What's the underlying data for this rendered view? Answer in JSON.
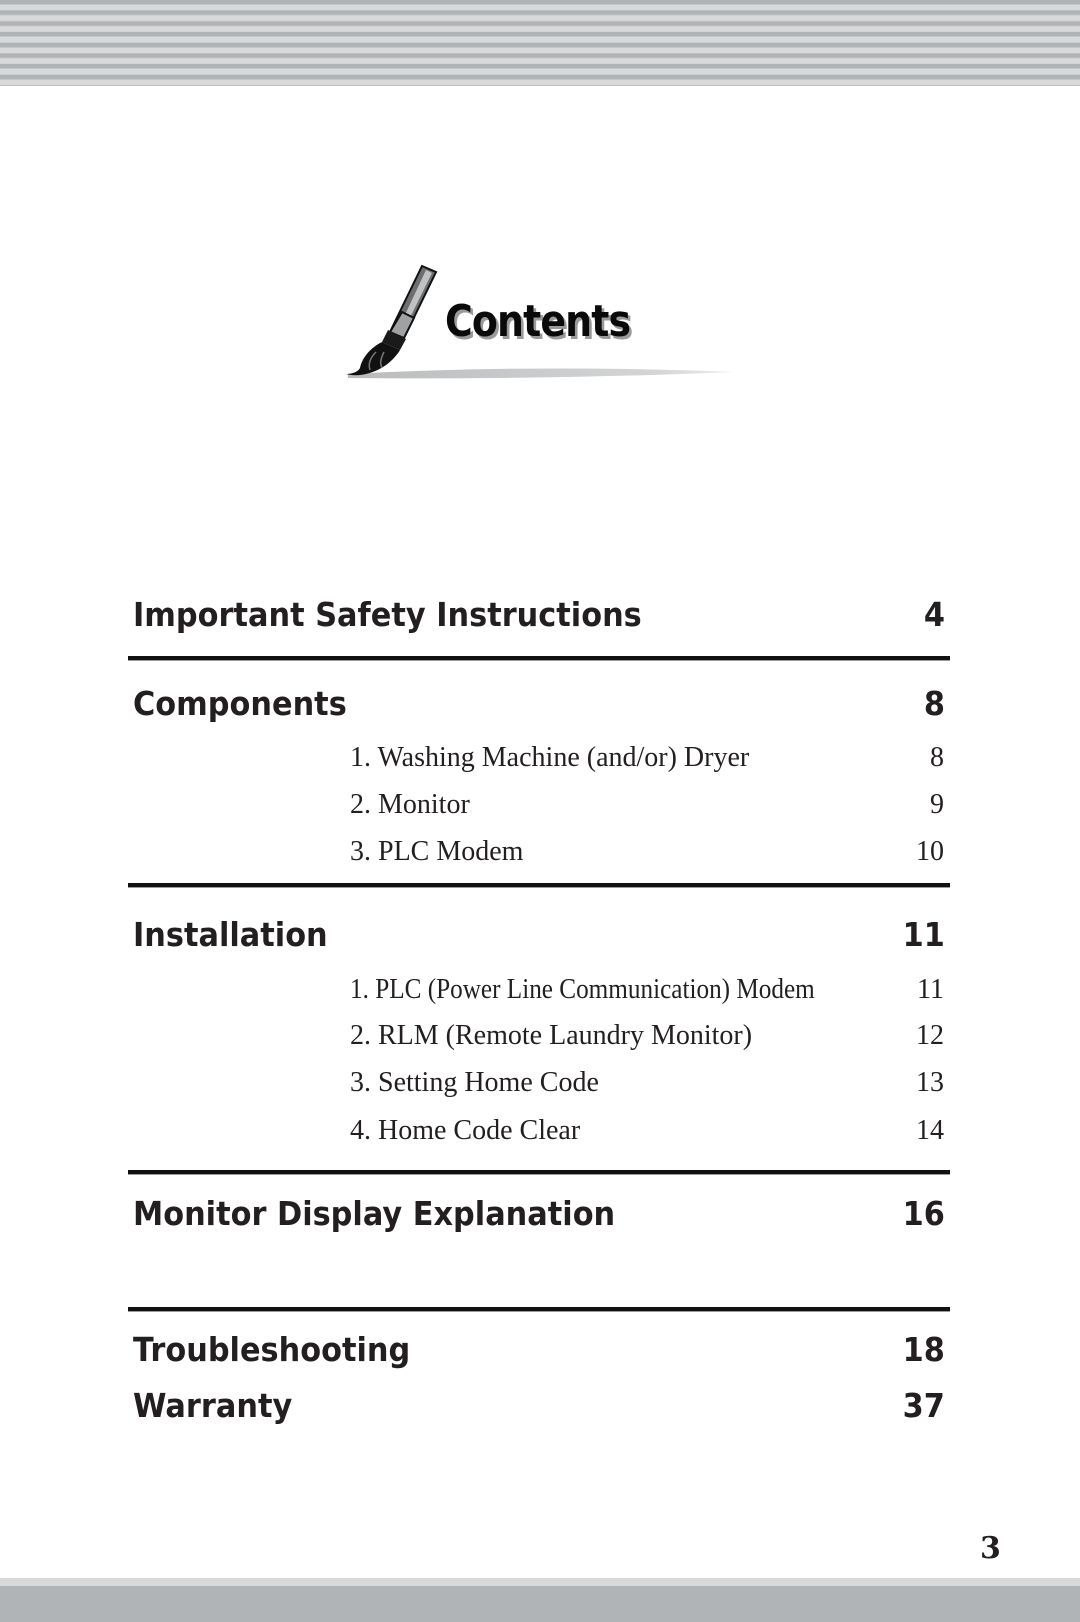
{
  "logo": {
    "title": "Contents",
    "icon": "paintbrush-icon"
  },
  "toc": {
    "sections": [
      {
        "title": "Important Safety Instructions",
        "page": "4",
        "items": []
      },
      {
        "title": "Components",
        "page": "8",
        "items": [
          {
            "label": "1. Washing Machine (and/or) Dryer",
            "page": "8"
          },
          {
            "label": "2. Monitor",
            "page": "9"
          },
          {
            "label": "3. PLC Modem",
            "page": "10"
          }
        ]
      },
      {
        "title": "Installation",
        "page": "11",
        "items": [
          {
            "label": "1. PLC (Power Line Communication) Modem",
            "page": "11"
          },
          {
            "label": "2. RLM (Remote Laundry Monitor)",
            "page": "12"
          },
          {
            "label": "3. Setting Home Code",
            "page": "13"
          },
          {
            "label": "4. Home Code Clear",
            "page": "14"
          }
        ]
      },
      {
        "title": "Monitor Display Explanation",
        "page": "16",
        "items": []
      },
      {
        "title": "Troubleshooting",
        "page": "18",
        "items": []
      },
      {
        "title": "Warranty",
        "page": "37",
        "items": []
      }
    ]
  },
  "footer": {
    "page_number": "3"
  }
}
